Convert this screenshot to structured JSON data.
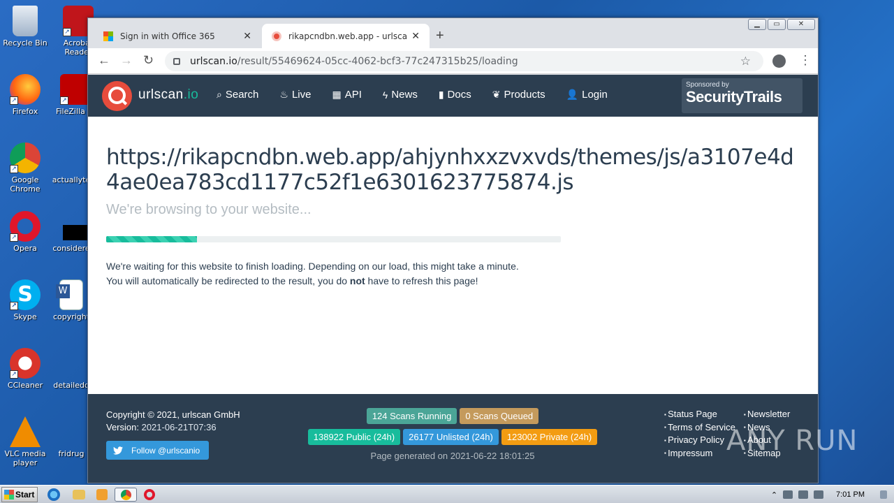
{
  "desktop": {
    "icons": [
      {
        "label": "Recycle Bin"
      },
      {
        "label": "Acrobat Reader"
      },
      {
        "label": "Firefox"
      },
      {
        "label": "FileZilla Cl"
      },
      {
        "label": "Google Chrome"
      },
      {
        "label": "actuallyte"
      },
      {
        "label": "Opera"
      },
      {
        "label": "considere"
      },
      {
        "label": "Skype"
      },
      {
        "label": "copyright"
      },
      {
        "label": "CCleaner"
      },
      {
        "label": "detailedo"
      },
      {
        "label": "VLC media player"
      },
      {
        "label": "fridrug"
      }
    ]
  },
  "browser": {
    "tabs": [
      {
        "label": "Sign in with Office 365",
        "active": false
      },
      {
        "label": "rikapcndbn.web.app - urlscan.io",
        "active": true
      }
    ],
    "url_host": "urlscan.io",
    "url_path": "/result/55469624-05cc-4062-bcf3-77c247315b25/loading"
  },
  "site": {
    "brand_main": "urlscan",
    "brand_tld": ".io",
    "nav": [
      {
        "label": "Search",
        "icon": "search-icon"
      },
      {
        "label": "Live",
        "icon": "fire-icon"
      },
      {
        "label": "API",
        "icon": "qrcode-icon"
      },
      {
        "label": "News",
        "icon": "bolt-icon"
      },
      {
        "label": "Docs",
        "icon": "bookmark-icon"
      },
      {
        "label": "Products",
        "icon": "leaf-icon"
      },
      {
        "label": "Login",
        "icon": "user-icon"
      }
    ],
    "sponsor_by": "Sponsored by",
    "sponsor_name": "SecurityTrails"
  },
  "main": {
    "url_title": "https://rikapcndbn.web.app/ahjynhxxzvxvds/themes/js/a3107e4d4ae0ea783cd1177c52f1e6301623775874.js",
    "subtitle": "We're browsing to your website...",
    "progress_fraction": 0.2,
    "msg_line1": "We're waiting for this website to finish loading. Depending on our load, this might take a minute.",
    "msg_line2_pre": "You will automatically be redirected to the result, you do ",
    "msg_line2_bold": "not",
    "msg_line2_post": " have to refresh this page!"
  },
  "footer": {
    "copyright": "Copyright © 2021, urlscan GmbH",
    "version_label": "Version: ",
    "version_value": "2021-06-21T07:36",
    "twitter": "Follow @urlscanio",
    "badges_row1": [
      {
        "text": "124 Scans Running",
        "color": "#4ba597"
      },
      {
        "text": "0 Scans Queued",
        "color": "#c49a5c"
      }
    ],
    "badges_row2": [
      {
        "text": "138922 Public (24h)",
        "color": "#18bc9c"
      },
      {
        "text": "26177 Unlisted (24h)",
        "color": "#3498db"
      },
      {
        "text": "123002 Private (24h)",
        "color": "#f39c12"
      }
    ],
    "page_generated": "Page generated on 2021-06-22 18:01:25",
    "links_col1": [
      "Status Page",
      "Terms of Service",
      "Privacy Policy",
      "Impressum"
    ],
    "links_col2": [
      "Newsletter",
      "News",
      "About",
      "Sitemap"
    ]
  },
  "watermark": "ANY RUN",
  "taskbar": {
    "start": "Start",
    "clock": "7:01 PM"
  }
}
